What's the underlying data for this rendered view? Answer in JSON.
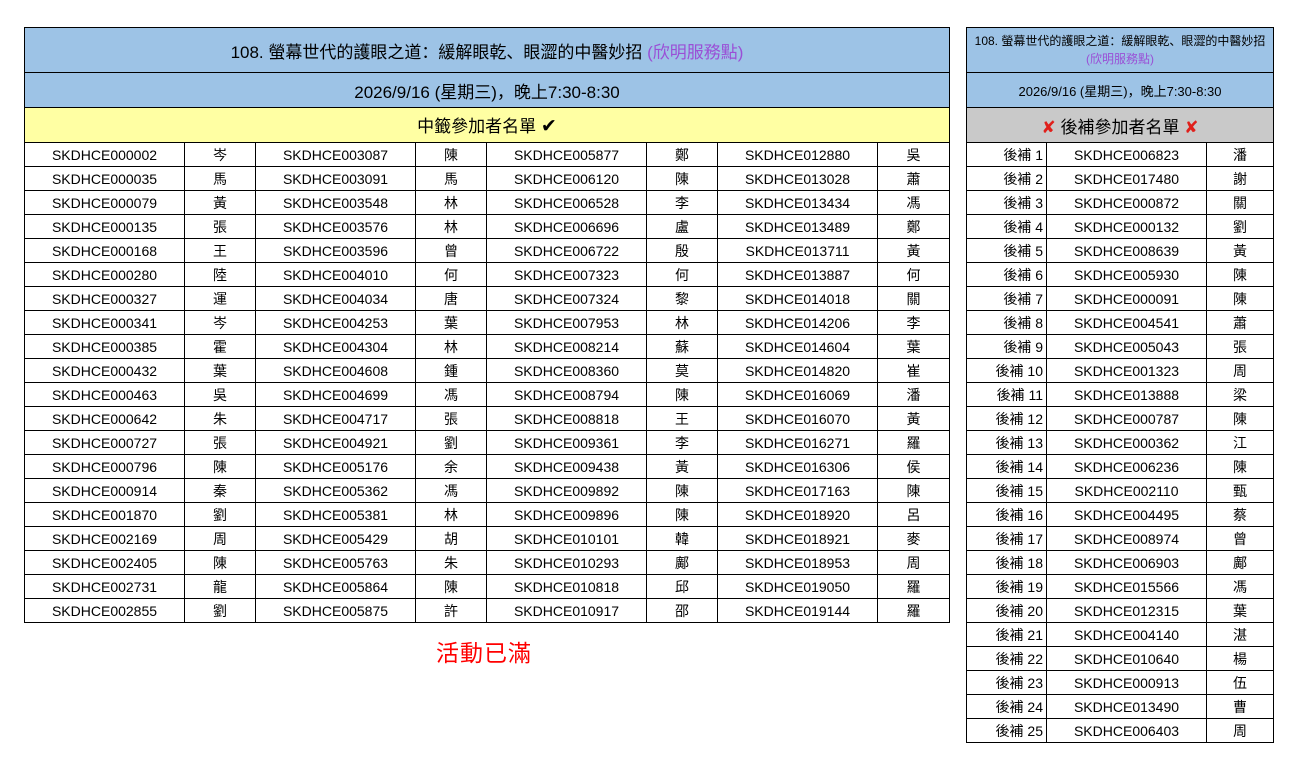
{
  "main": {
    "title": "108. 螢幕世代的護眼之道：緩解眼乾、眼澀的中醫妙招",
    "location": "(欣明服務點)",
    "date": "2026/9/16 (星期三)，晚上7:30-8:30",
    "winners_label": "中籤參加者名單",
    "winners_icon": "check-icon",
    "rows": [
      [
        "SKDHCE000002",
        "岑",
        "SKDHCE003087",
        "陳",
        "SKDHCE005877",
        "鄭",
        "SKDHCE012880",
        "吳"
      ],
      [
        "SKDHCE000035",
        "馬",
        "SKDHCE003091",
        "馬",
        "SKDHCE006120",
        "陳",
        "SKDHCE013028",
        "蕭"
      ],
      [
        "SKDHCE000079",
        "黃",
        "SKDHCE003548",
        "林",
        "SKDHCE006528",
        "李",
        "SKDHCE013434",
        "馮"
      ],
      [
        "SKDHCE000135",
        "張",
        "SKDHCE003576",
        "林",
        "SKDHCE006696",
        "盧",
        "SKDHCE013489",
        "鄭"
      ],
      [
        "SKDHCE000168",
        "王",
        "SKDHCE003596",
        "曾",
        "SKDHCE006722",
        "殷",
        "SKDHCE013711",
        "黃"
      ],
      [
        "SKDHCE000280",
        "陸",
        "SKDHCE004010",
        "何",
        "SKDHCE007323",
        "何",
        "SKDHCE013887",
        "何"
      ],
      [
        "SKDHCE000327",
        "運",
        "SKDHCE004034",
        "唐",
        "SKDHCE007324",
        "黎",
        "SKDHCE014018",
        "關"
      ],
      [
        "SKDHCE000341",
        "岑",
        "SKDHCE004253",
        "葉",
        "SKDHCE007953",
        "林",
        "SKDHCE014206",
        "李"
      ],
      [
        "SKDHCE000385",
        "霍",
        "SKDHCE004304",
        "林",
        "SKDHCE008214",
        "蘇",
        "SKDHCE014604",
        "葉"
      ],
      [
        "SKDHCE000432",
        "葉",
        "SKDHCE004608",
        "鍾",
        "SKDHCE008360",
        "莫",
        "SKDHCE014820",
        "崔"
      ],
      [
        "SKDHCE000463",
        "吳",
        "SKDHCE004699",
        "馮",
        "SKDHCE008794",
        "陳",
        "SKDHCE016069",
        "潘"
      ],
      [
        "SKDHCE000642",
        "朱",
        "SKDHCE004717",
        "張",
        "SKDHCE008818",
        "王",
        "SKDHCE016070",
        "黃"
      ],
      [
        "SKDHCE000727",
        "張",
        "SKDHCE004921",
        "劉",
        "SKDHCE009361",
        "李",
        "SKDHCE016271",
        "羅"
      ],
      [
        "SKDHCE000796",
        "陳",
        "SKDHCE005176",
        "余",
        "SKDHCE009438",
        "黃",
        "SKDHCE016306",
        "侯"
      ],
      [
        "SKDHCE000914",
        "秦",
        "SKDHCE005362",
        "馮",
        "SKDHCE009892",
        "陳",
        "SKDHCE017163",
        "陳"
      ],
      [
        "SKDHCE001870",
        "劉",
        "SKDHCE005381",
        "林",
        "SKDHCE009896",
        "陳",
        "SKDHCE018920",
        "呂"
      ],
      [
        "SKDHCE002169",
        "周",
        "SKDHCE005429",
        "胡",
        "SKDHCE010101",
        "韓",
        "SKDHCE018921",
        "麥"
      ],
      [
        "SKDHCE002405",
        "陳",
        "SKDHCE005763",
        "朱",
        "SKDHCE010293",
        "鄺",
        "SKDHCE018953",
        "周"
      ],
      [
        "SKDHCE002731",
        "龍",
        "SKDHCE005864",
        "陳",
        "SKDHCE010818",
        "邱",
        "SKDHCE019050",
        "羅"
      ],
      [
        "SKDHCE002855",
        "劉",
        "SKDHCE005875",
        "許",
        "SKDHCE010917",
        "邵",
        "SKDHCE019144",
        "羅"
      ]
    ],
    "full_notice": "活動已滿"
  },
  "waitlist": {
    "title": "108. 螢幕世代的護眼之道：緩解眼乾、眼澀的中醫妙招",
    "location": "(欣明服務點)",
    "date": "2026/9/16 (星期三)，晚上7:30-8:30",
    "label": "後補參加者名單",
    "cross": "✘",
    "rows": [
      [
        "後補 1",
        "SKDHCE006823",
        "潘"
      ],
      [
        "後補 2",
        "SKDHCE017480",
        "謝"
      ],
      [
        "後補 3",
        "SKDHCE000872",
        "關"
      ],
      [
        "後補 4",
        "SKDHCE000132",
        "劉"
      ],
      [
        "後補 5",
        "SKDHCE008639",
        "黃"
      ],
      [
        "後補 6",
        "SKDHCE005930",
        "陳"
      ],
      [
        "後補 7",
        "SKDHCE000091",
        "陳"
      ],
      [
        "後補 8",
        "SKDHCE004541",
        "蕭"
      ],
      [
        "後補 9",
        "SKDHCE005043",
        "張"
      ],
      [
        "後補 10",
        "SKDHCE001323",
        "周"
      ],
      [
        "後補 11",
        "SKDHCE013888",
        "梁"
      ],
      [
        "後補 12",
        "SKDHCE000787",
        "陳"
      ],
      [
        "後補 13",
        "SKDHCE000362",
        "江"
      ],
      [
        "後補 14",
        "SKDHCE006236",
        "陳"
      ],
      [
        "後補 15",
        "SKDHCE002110",
        "甄"
      ],
      [
        "後補 16",
        "SKDHCE004495",
        "蔡"
      ],
      [
        "後補 17",
        "SKDHCE008974",
        "曾"
      ],
      [
        "後補 18",
        "SKDHCE006903",
        "鄺"
      ],
      [
        "後補 19",
        "SKDHCE015566",
        "馮"
      ],
      [
        "後補 20",
        "SKDHCE012315",
        "葉"
      ],
      [
        "後補 21",
        "SKDHCE004140",
        "湛"
      ],
      [
        "後補 22",
        "SKDHCE010640",
        "楊"
      ],
      [
        "後補 23",
        "SKDHCE000913",
        "伍"
      ],
      [
        "後補 24",
        "SKDHCE013490",
        "曹"
      ],
      [
        "後補 25",
        "SKDHCE006403",
        "周"
      ]
    ]
  },
  "colors": {
    "header_blue": "#9dc3e6",
    "winners_yellow": "#ffffa3",
    "waitlist_gray": "#c9c9c9",
    "location_purple": "#9a4fd6",
    "cross_red": "#e0201b",
    "notice_red": "#ff0000"
  }
}
